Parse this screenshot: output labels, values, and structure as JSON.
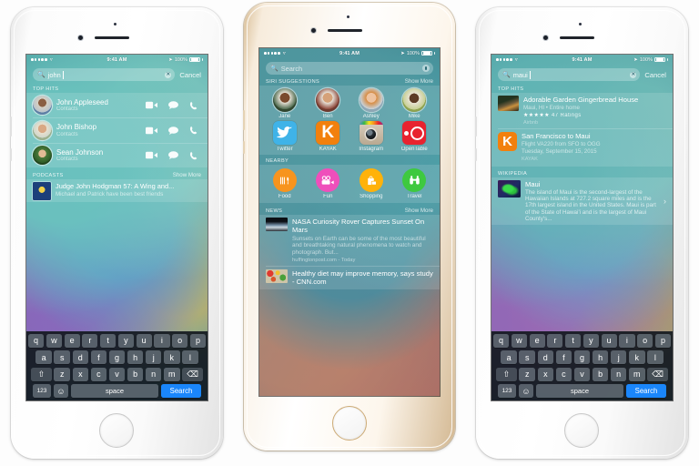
{
  "status_bar": {
    "time": "9:41 AM",
    "battery": "100%",
    "signal_dots": 5
  },
  "phones": [
    {
      "id": "left",
      "frame_color": "silver",
      "search": {
        "value": "john",
        "placeholder": "",
        "cancel_label": "Cancel",
        "icon": "search-icon",
        "clear_icon": "clear-icon"
      },
      "sections": [
        {
          "title": "TOP HITS",
          "more": ""
        },
        {
          "title": "PODCASTS",
          "more": "Show More"
        }
      ],
      "top_hits": [
        {
          "name": "John Appleseed",
          "subtitle": "Contacts",
          "actions": [
            "video-icon",
            "message-icon",
            "phone-icon"
          ]
        },
        {
          "name": "John Bishop",
          "subtitle": "Contacts",
          "actions": [
            "video-icon",
            "message-icon",
            "phone-icon"
          ]
        },
        {
          "name": "Sean Johnson",
          "subtitle": "Contacts",
          "actions": [
            "video-icon",
            "message-icon",
            "phone-icon"
          ]
        }
      ],
      "podcast": {
        "title": "Judge John Hodgman 57: A Wing and...",
        "subtitle": "Michael and Patrick have been best friends"
      }
    },
    {
      "id": "middle",
      "frame_color": "gold",
      "search": {
        "value": "",
        "placeholder": "Search",
        "mic_icon": "microphone-icon",
        "icon": "search-icon"
      },
      "siri_section": {
        "title": "SIRI SUGGESTIONS",
        "more": "Show More"
      },
      "siri_people": [
        {
          "label": "Jane"
        },
        {
          "label": "Ben"
        },
        {
          "label": "Ashley"
        },
        {
          "label": "Mike"
        }
      ],
      "siri_apps": [
        {
          "label": "Twitter",
          "color": "#3fb3e8"
        },
        {
          "label": "KAYAK",
          "color": "#f2800d"
        },
        {
          "label": "Instagram",
          "color": "#c9b49a"
        },
        {
          "label": "OpenTable",
          "color": "#e8232f"
        }
      ],
      "nearby_section": {
        "title": "NEARBY",
        "more": ""
      },
      "nearby": [
        {
          "label": "Food",
          "color": "#f7941e",
          "icon": "cutlery-icon"
        },
        {
          "label": "Fun",
          "color": "#ef4fbb",
          "icon": "movie-camera-icon"
        },
        {
          "label": "Shopping",
          "color": "#ffb20a",
          "icon": "shopping-bag-icon"
        },
        {
          "label": "Travel",
          "color": "#3ec93f",
          "icon": "binoculars-icon"
        }
      ],
      "news_section": {
        "title": "NEWS",
        "more": "Show More"
      },
      "news": [
        {
          "title": "NASA Curiosity Rover Captures Sunset On Mars",
          "body": "Sunsets on Earth can be some of the most beautiful and breathtaking natural phenomena to watch and photograph. But...",
          "source": "huffingtonpost.com - Today"
        },
        {
          "title": "Healthy diet may improve memory, says study - CNN.com",
          "body": "",
          "source": ""
        }
      ]
    },
    {
      "id": "right",
      "frame_color": "silver",
      "search": {
        "value": "maui",
        "placeholder": "",
        "cancel_label": "Cancel",
        "icon": "search-icon",
        "clear_icon": "clear-icon"
      },
      "sections": [
        {
          "title": "TOP HITS",
          "more": ""
        },
        {
          "title": "WIKIPEDIA",
          "more": ""
        }
      ],
      "top_hits": [
        {
          "title": "Adorable Garden Gingerbread House",
          "subtitle": "Maui, HI • Entire home",
          "stars": "★★★★★",
          "ratings": "47 Ratings",
          "source": "Airbnb"
        },
        {
          "title": "San Francisco to Maui",
          "line2": "Flight VA220 from SFO to OGG",
          "line3": "Tuesday, September 15, 2015",
          "source": "KAYAK",
          "icon_letter": "K"
        }
      ],
      "wikipedia": {
        "title": "Maui",
        "body": "The island of Maui is the second-largest of the Hawaiian Islands at 727.2 square miles and is the 17th largest island in the United States. Maui is part of the State of Hawai'i and is the largest of Maui County's...",
        "chevron": "chevron-right-icon"
      }
    }
  ],
  "keyboard": {
    "row1": [
      "q",
      "w",
      "e",
      "r",
      "t",
      "y",
      "u",
      "i",
      "o",
      "p"
    ],
    "row2": [
      "a",
      "s",
      "d",
      "f",
      "g",
      "h",
      "j",
      "k",
      "l"
    ],
    "row3": [
      "z",
      "x",
      "c",
      "v",
      "b",
      "n",
      "m"
    ],
    "shift": "shift-icon",
    "backspace": "backspace-icon",
    "numbers": "123",
    "emoji": "emoji-icon",
    "space": "space",
    "return": "Search"
  },
  "colors": {
    "accent_blue": "#1a86fb",
    "kayak_orange": "#f2800d",
    "twitter_blue": "#3fb3e8",
    "opentable_red": "#e8232f"
  }
}
